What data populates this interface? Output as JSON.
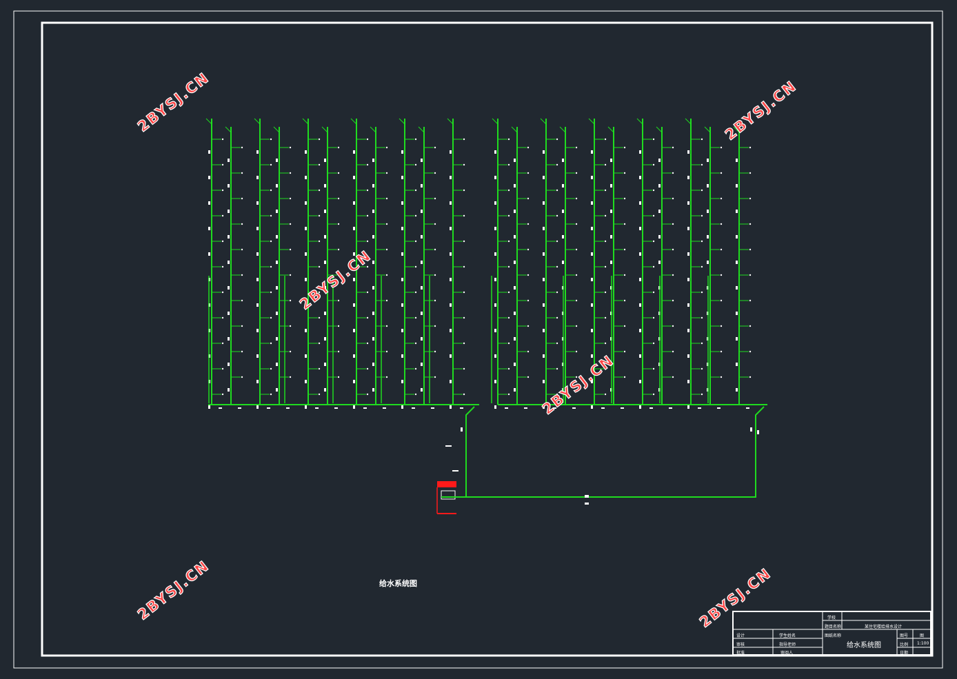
{
  "drawing": {
    "title": "给水系统图",
    "watermarks": [
      "2BYSJ.CN",
      "2BYSJ.CN",
      "2BYSJ.CN",
      "2BYSJ.CN",
      "2BYSJ.CN",
      "2BYSJ.CN",
      "2BYSJ.CN"
    ]
  },
  "title_block": {
    "r1": "学校",
    "r2a": "题目名称",
    "r2b": "某住宅楼给排水设计",
    "design_label": "设计",
    "student_label": "学生姓名",
    "review_label": "审核",
    "teacher_label": "指导老师",
    "approve_label": "批准",
    "reviewer_label": "审阅人",
    "stage_label": "图纸名称",
    "sheet_title": "给水系统图",
    "no_label": "图号",
    "no_value": "图",
    "scale_label": "比例",
    "scale_value": "1:100",
    "date_label": "日期"
  },
  "colors": {
    "background": "#212830",
    "frame": "#ffffff",
    "pipe": "#1fdc1f",
    "accent": "#ff1a1a",
    "watermark": "#ff4646"
  }
}
